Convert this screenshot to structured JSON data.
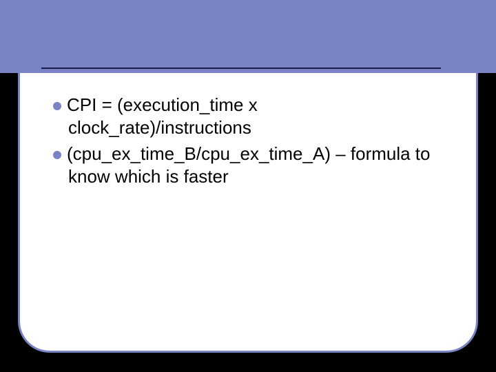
{
  "bullets": [
    "CPI = (execution_time x clock_rate)/instructions",
    "(cpu_ex_time_B/cpu_ex_time_A) – formula to know which is faster"
  ]
}
